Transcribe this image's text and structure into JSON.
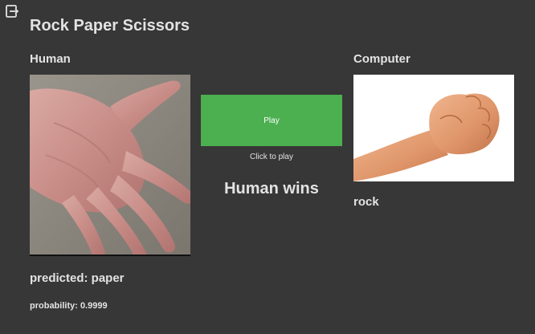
{
  "app": {
    "title": "Rock Paper Scissors"
  },
  "toolbar": {
    "exit_icon": "exit-icon"
  },
  "human": {
    "label": "Human",
    "image_subject": "open hand (paper)",
    "prediction": "predicted: paper",
    "probability": "probability: 0.9999"
  },
  "computer": {
    "label": "Computer",
    "image_subject": "fist (rock)",
    "choice": "rock"
  },
  "controls": {
    "play_label": "Play",
    "play_hint": "Click to play"
  },
  "result": {
    "text": "Human wins"
  },
  "colors": {
    "background": "#373737",
    "text": "#e3e3e3",
    "play_button": "#4caf50"
  }
}
